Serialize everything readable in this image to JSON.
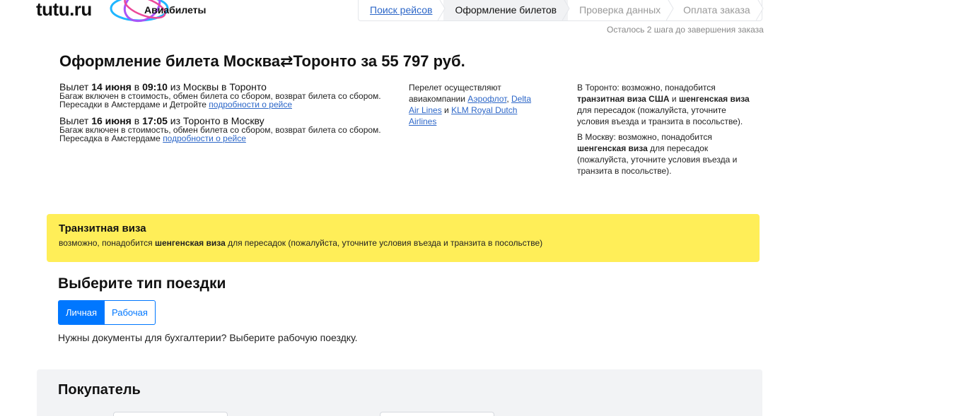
{
  "header": {
    "logo_text": "tutu.ru",
    "section_label": "Авиабилеты"
  },
  "steps": [
    {
      "label": "Поиск рейсов",
      "state": "link"
    },
    {
      "label": "Оформление билетов",
      "state": "active"
    },
    {
      "label": "Проверка данных",
      "state": "muted"
    },
    {
      "label": "Оплата заказа",
      "state": "muted"
    }
  ],
  "steps_note": "Осталось 2 шага до завершения заказа",
  "title": "Оформление билета Москва⇄Торонто за 55 797 руб.",
  "flights": [
    {
      "prefix": "Вылет ",
      "date": "14 июня",
      "mid": " в ",
      "time": "09:10",
      "route": " из Москвы в Торонто",
      "details": "Багаж включен в стоимость, обмен билета со сбором, возврат билета со сбором.",
      "transfer": "Пересадки в Амстердаме и Детройте ",
      "link": "подробности о рейсе"
    },
    {
      "prefix": "Вылет ",
      "date": "16 июня",
      "mid": " в ",
      "time": "17:05",
      "route": " из Торонто в Москву",
      "details": "Багаж включен в стоимость, обмен билета со сбором, возврат билета со сбором.",
      "transfer": "Пересадка в Амстердаме ",
      "link": "подробности о рейсе"
    }
  ],
  "airlines": {
    "prefix": "Перелет осуществляют авиакомпании ",
    "a1": "Аэрофлот",
    "sep1": ", ",
    "a2": "Delta Air Lines",
    "sep2": " и ",
    "a3": "KLM Royal Dutch Airlines"
  },
  "visa_info": {
    "toronto": {
      "pre": "В Торонто: возможно, понадобится ",
      "b1": "транзитная виза США",
      "mid": " и ",
      "b2": "шенгенская виза",
      "post": " для пересадок (пожалуйста, уточните условия въезда и транзита в посольстве)."
    },
    "moscow": {
      "pre": "В Москву: возможно, понадобится ",
      "b1": "шенгенская виза",
      "post": " для пересадок (пожалуйста, уточните условия въезда и транзита в посольстве)."
    }
  },
  "banner": {
    "title": "Транзитная виза",
    "pre": "возможно, понадобится ",
    "bold": "шенгенская виза",
    "post": " для пересадок (пожалуйста, уточните условия въезда и транзита в посольстве)"
  },
  "trip": {
    "heading": "Выберите тип поездки",
    "option_personal": "Личная",
    "option_business": "Рабочая",
    "note": "Нужны документы для бухгалтерии? Выберите рабочую поездку."
  },
  "buyer": {
    "title": "Покупатель"
  },
  "colors": {
    "accent": "#0077ff",
    "link": "#2d67c8",
    "banner": "#ffee58"
  }
}
